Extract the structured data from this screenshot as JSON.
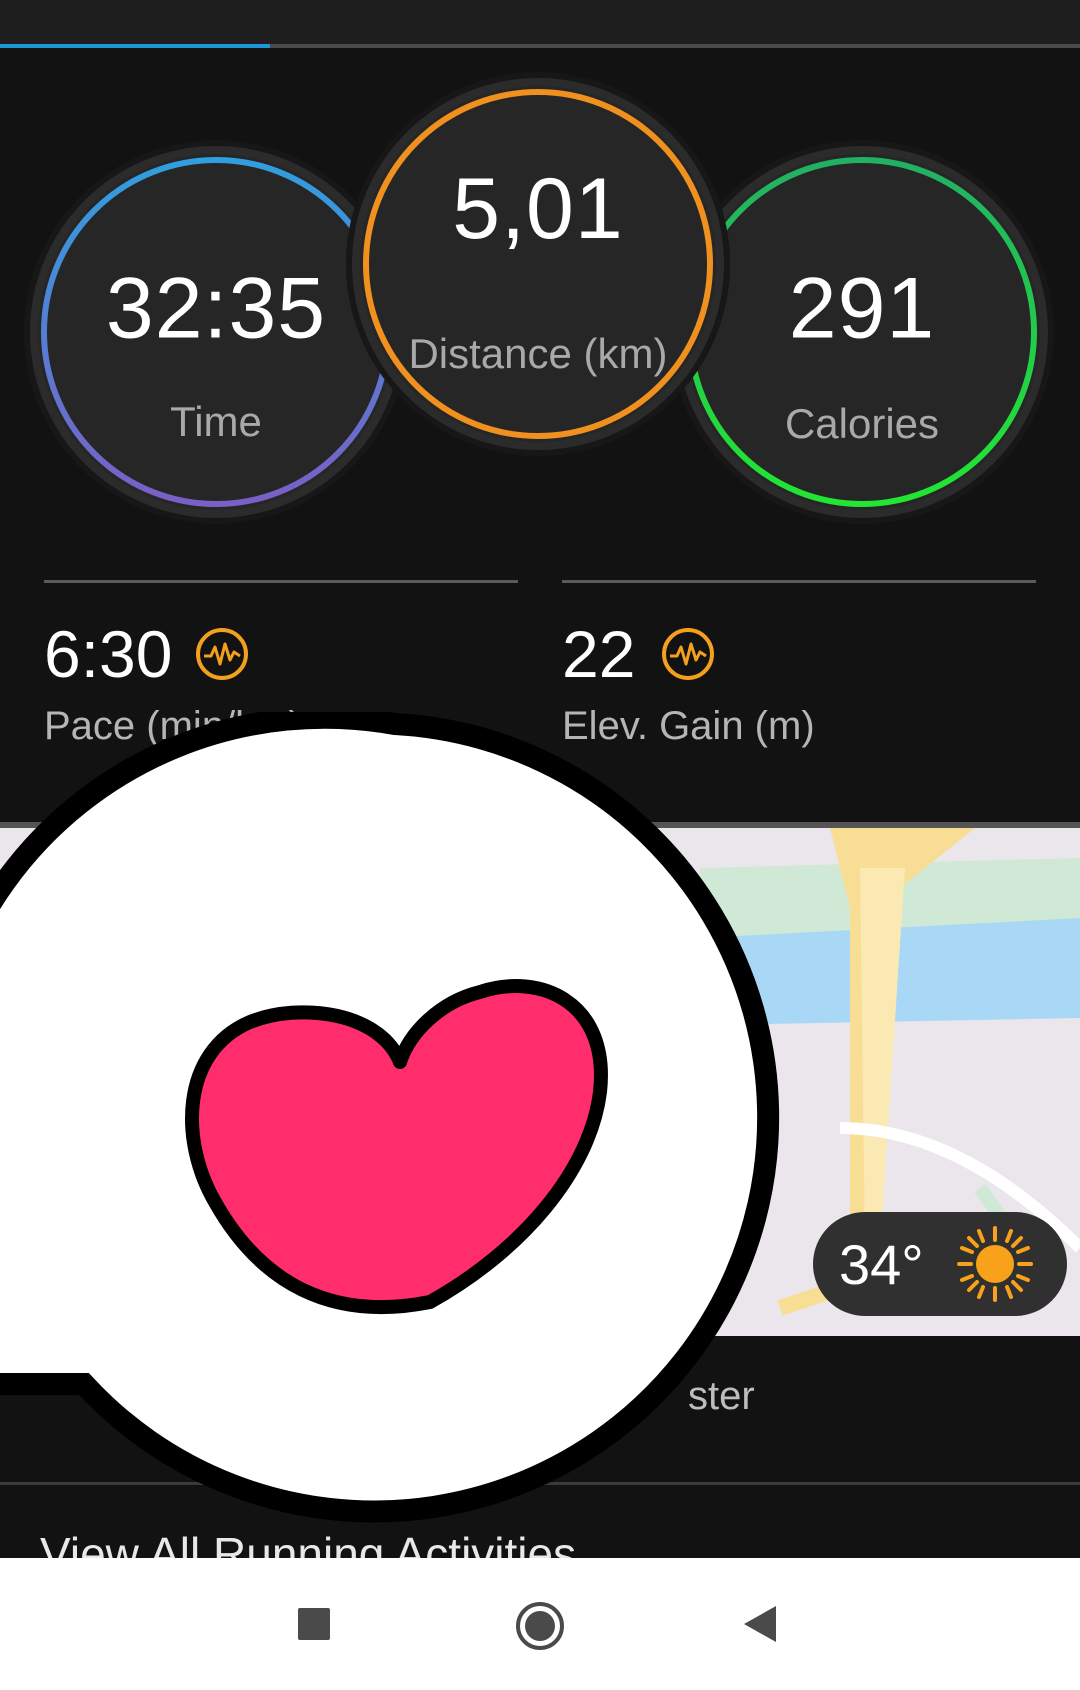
{
  "progress": {
    "percent": 25
  },
  "rings": {
    "time": {
      "value": "32:35",
      "label": "Time"
    },
    "distance": {
      "value": "5,01",
      "label": "Distance (km)"
    },
    "calories": {
      "value": "291",
      "label": "Calories"
    }
  },
  "stats": {
    "pace": {
      "value": "6:30",
      "label": "Pace (min/km)",
      "icon": "activity-pulse-icon"
    },
    "elevation": {
      "value": "22",
      "label": "Elev. Gain (m)",
      "icon": "activity-pulse-icon"
    }
  },
  "weather": {
    "temperature": "34°",
    "icon": "sun-icon"
  },
  "partial_text": "ster",
  "view_all_label": "View All Running Activities",
  "sticker": {
    "icon": "heart-speech-bubble-icon"
  },
  "colors": {
    "time_ring_gradient": [
      "#2f9fe0",
      "#7a5fc6"
    ],
    "distance_ring": "#f0901e",
    "calories_ring_gradient": [
      "#22b063",
      "#22e632"
    ],
    "accent_orange": "#f2a01e",
    "progress_blue": "#1e96d6",
    "heart": "#ff2d6b"
  },
  "nav": {
    "recent_icon": "square-recents-icon",
    "home_icon": "circle-home-icon",
    "back_icon": "triangle-back-icon"
  }
}
